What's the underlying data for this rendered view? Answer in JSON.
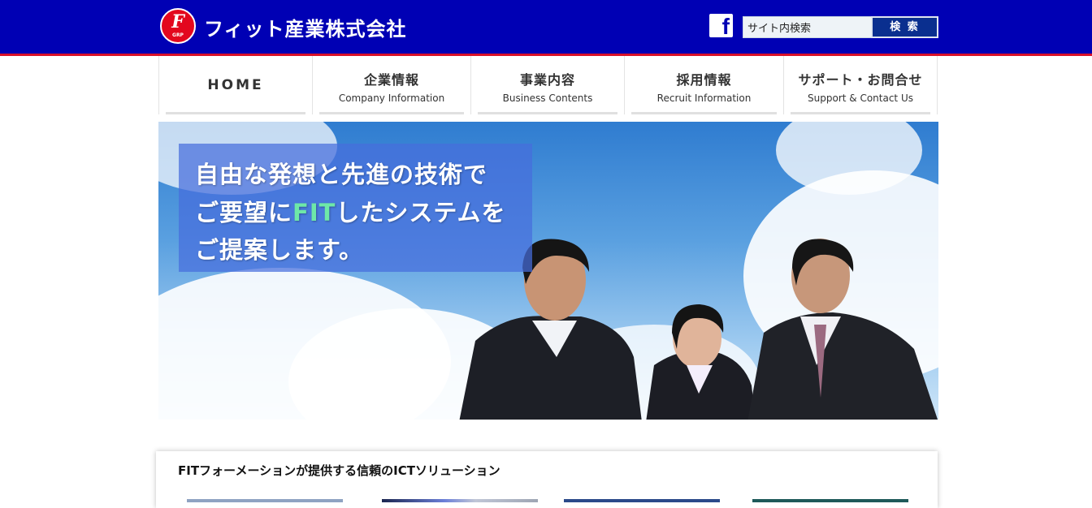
{
  "header": {
    "logo_mark": "F",
    "logo_sub": "GRP",
    "company_name": "フィット産業株式会社",
    "facebook_icon": "facebook-icon",
    "search": {
      "placeholder": "サイト内検索",
      "button_label": "検 索"
    },
    "colors": {
      "header_bg": "#0000b4",
      "accent_line": "#d8102a",
      "logo": "#e3071e"
    }
  },
  "nav": {
    "home": "HOME",
    "items": [
      {
        "label": "企業情報",
        "sub": "Company Information"
      },
      {
        "label": "事業内容",
        "sub": "Business Contents"
      },
      {
        "label": "採用情報",
        "sub": "Recruit Information"
      },
      {
        "label": "サポート・お問合せ",
        "sub": "Support & Contact Us"
      }
    ]
  },
  "hero": {
    "line1": "自由な発想と先進の技術で",
    "line2_pre": "ご要望に",
    "line2_fit": "FIT",
    "line2_post": "したシステムを",
    "line3": "ご提案します。"
  },
  "section": {
    "title": "FITフォーメーションが提供する信頼のICTソリューション"
  }
}
